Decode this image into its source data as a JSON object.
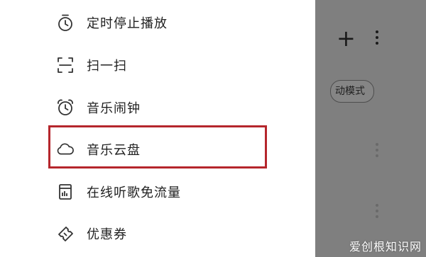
{
  "menu": {
    "items": [
      {
        "label": "定时停止播放",
        "icon": "timer-icon"
      },
      {
        "label": "扫一扫",
        "icon": "scan-icon"
      },
      {
        "label": "音乐闹钟",
        "icon": "alarm-clock-icon"
      },
      {
        "label": "音乐云盘",
        "icon": "cloud-icon"
      },
      {
        "label": "在线听歌免流量",
        "icon": "sim-card-icon"
      },
      {
        "label": "优惠券",
        "icon": "coupon-icon"
      }
    ]
  },
  "background": {
    "mode_chip_label": "动模式"
  },
  "watermark": "爱创根知识网",
  "colors": {
    "highlight_border": "#b5262c",
    "scrim": "#7f7f7f",
    "icon": "#333333"
  }
}
